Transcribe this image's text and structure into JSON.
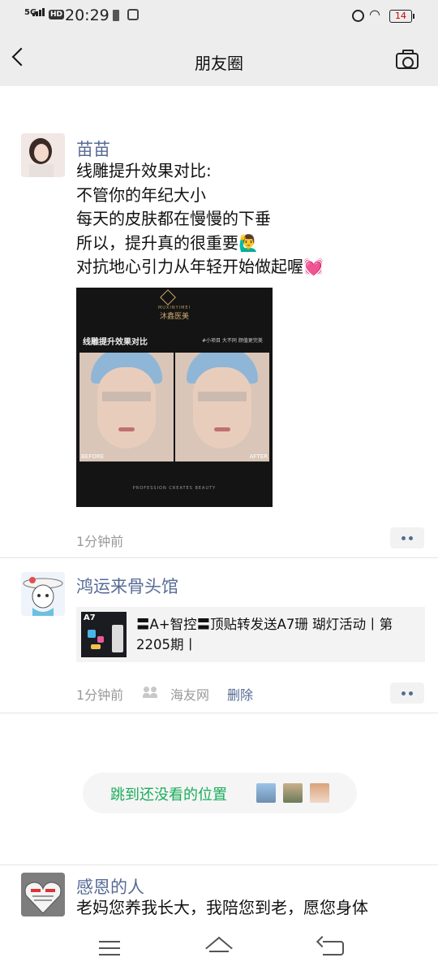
{
  "status_bar": {
    "network": "5G",
    "hd_badge": "HD",
    "time": "20:29",
    "battery": "14"
  },
  "header": {
    "title": "朋友圈",
    "back_icon": "chevron-left-icon",
    "camera_icon": "camera-icon"
  },
  "posts": [
    {
      "author": "苗苗",
      "text": "线雕提升效果对比:\n不管你的年纪大小\n每天的皮肤都在慢慢的下垂\n所以，提升真的很重要🙋‍♂️\n对抗地心引力从年轻开始做起喔💓",
      "image": {
        "brand_en": "MUXINYIMEI",
        "brand": "沐鑫医美",
        "caption": "线雕提升效果对比",
        "tag": "#小项目 大不同 颜值更完美",
        "before_label": "BEFORE",
        "after_label": "AFTER",
        "footer": "PROFESSION CREATES BEAUTY"
      },
      "time": "1分钟前"
    },
    {
      "author": "鸿运来骨头馆",
      "share": {
        "thumb_label": "A7",
        "text": "〓A+智控〓顶贴转发送A7珊 瑚灯活动丨第2205期丨"
      },
      "time": "1分钟前",
      "source": "海友网",
      "delete_label": "删除"
    },
    {
      "author": "感恩的人",
      "text": "老妈您养我长大，我陪您到老，愿您身体"
    }
  ],
  "jump_pill": {
    "label": "跳到还没看的位置"
  },
  "colors": {
    "link": "#576b95",
    "green": "#1aad5a",
    "header_bg": "#ededed"
  }
}
